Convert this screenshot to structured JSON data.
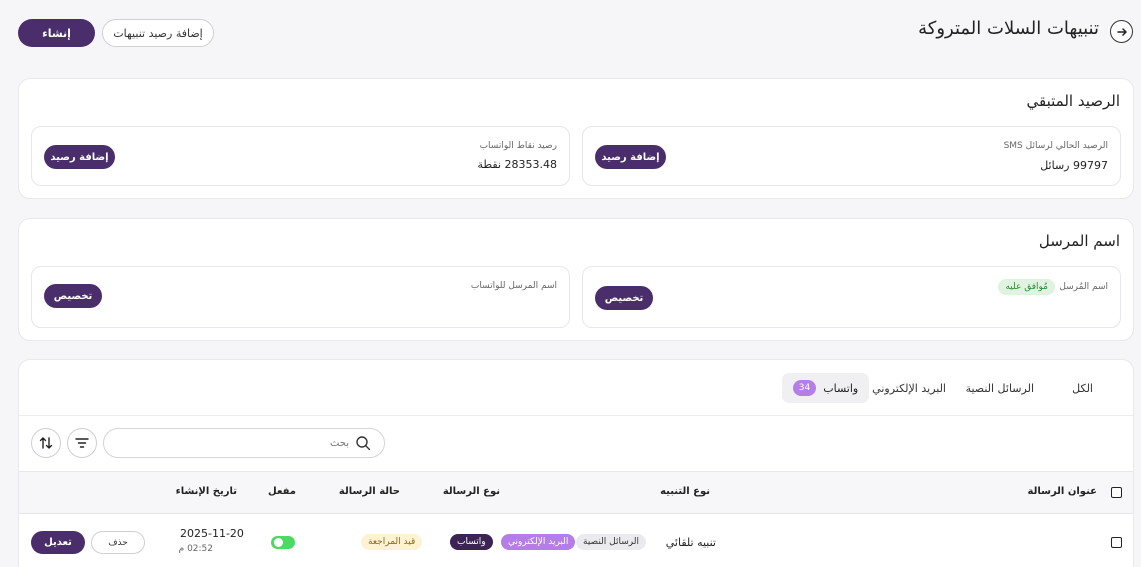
{
  "header": {
    "title": "تنبيهات السلات المتروكة",
    "create_label": "إنشاء",
    "add_balance_label": "إضافة رصيد تنبيهات"
  },
  "balance": {
    "title": "الرصيد المتبقي",
    "sms_label": "الرصيد الحالي لرسائل SMS",
    "sms_value": "99797 رسائل",
    "sms_button": "إضافة رصيد",
    "wa_label": "رصيد نقاط الواتساب",
    "wa_value": "28353.48 نقطة",
    "wa_button": "إضافة رصيد"
  },
  "sender": {
    "title": "اسم المرسل",
    "sms_label": "اسم المُرسل",
    "sms_status": "مُوافق عليه",
    "sms_button": "تخصيص",
    "wa_label": "اسم المرسل للواتساب",
    "wa_button": "تخصيص"
  },
  "tabs": [
    {
      "label": "الكل"
    },
    {
      "label": "الرسائل النصية"
    },
    {
      "label": "البريد الإلكتروني"
    },
    {
      "label": "واتساب",
      "count": "34"
    }
  ],
  "search": {
    "placeholder": "بحث"
  },
  "table": {
    "headers": {
      "title": "عنوان الرسالة",
      "alert_type": "نوع التنبيه",
      "message_type": "نوع الرسالة",
      "status": "حالة الرسالة",
      "enabled": "مفعل",
      "created": "تاريخ الإنشاء"
    },
    "rows": [
      {
        "alert_type": "تنبيه تلقائي",
        "channels": [
          "الرسائل النصية",
          "البريد الإلكتروني",
          "واتساب"
        ],
        "status": "قيد المراجعة",
        "enabled": true,
        "date": "2025-11-20",
        "time": "02:52 م",
        "delete_label": "حذف",
        "edit_label": "تعديل"
      }
    ]
  },
  "colors": {
    "primary": "#4a2d6b",
    "accent_purple": "#b47ee8",
    "approved_bg": "#dff3e0",
    "approved_text": "#2f8a3a",
    "review_bg": "#fdf3d4",
    "review_text": "#8a6a14",
    "toggle_on": "#4cd964"
  }
}
